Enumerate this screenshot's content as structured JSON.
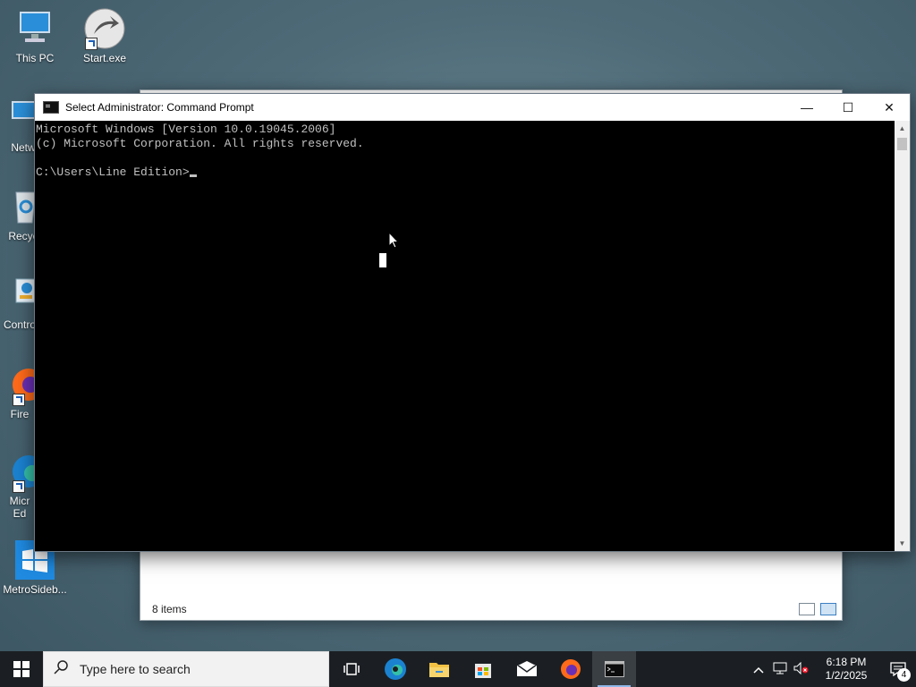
{
  "desktop": {
    "icons": [
      {
        "label": "This PC"
      },
      {
        "label": "Start.exe"
      },
      {
        "label": "Netw"
      },
      {
        "label": "Recyc"
      },
      {
        "label": "Contro"
      },
      {
        "label": "Fire"
      },
      {
        "label": "Micr\nEd"
      },
      {
        "label": "MetroSideb..."
      }
    ]
  },
  "explorer": {
    "status_text": "8 items"
  },
  "cmd": {
    "title": "Select Administrator: Command Prompt",
    "console_lines": [
      "Microsoft Windows [Version 10.0.19045.2006]",
      "(c) Microsoft Corporation. All rights reserved.",
      "",
      "C:\\Users\\Line Edition>"
    ],
    "controls": {
      "minimize": "—",
      "maximize": "☐",
      "close": "✕"
    }
  },
  "taskbar": {
    "search_placeholder": "Type here to search",
    "pinned": [
      "task-view",
      "edge",
      "file-explorer",
      "store",
      "mail",
      "firefox",
      "command-prompt"
    ],
    "active": "command-prompt",
    "clock_time": "6:18 PM",
    "clock_date": "1/2/2025",
    "notification_count": "4"
  },
  "colors": {
    "console_bg": "#000000",
    "console_fg": "#c0c0c0",
    "taskbar_bg": "#1b1f23"
  }
}
